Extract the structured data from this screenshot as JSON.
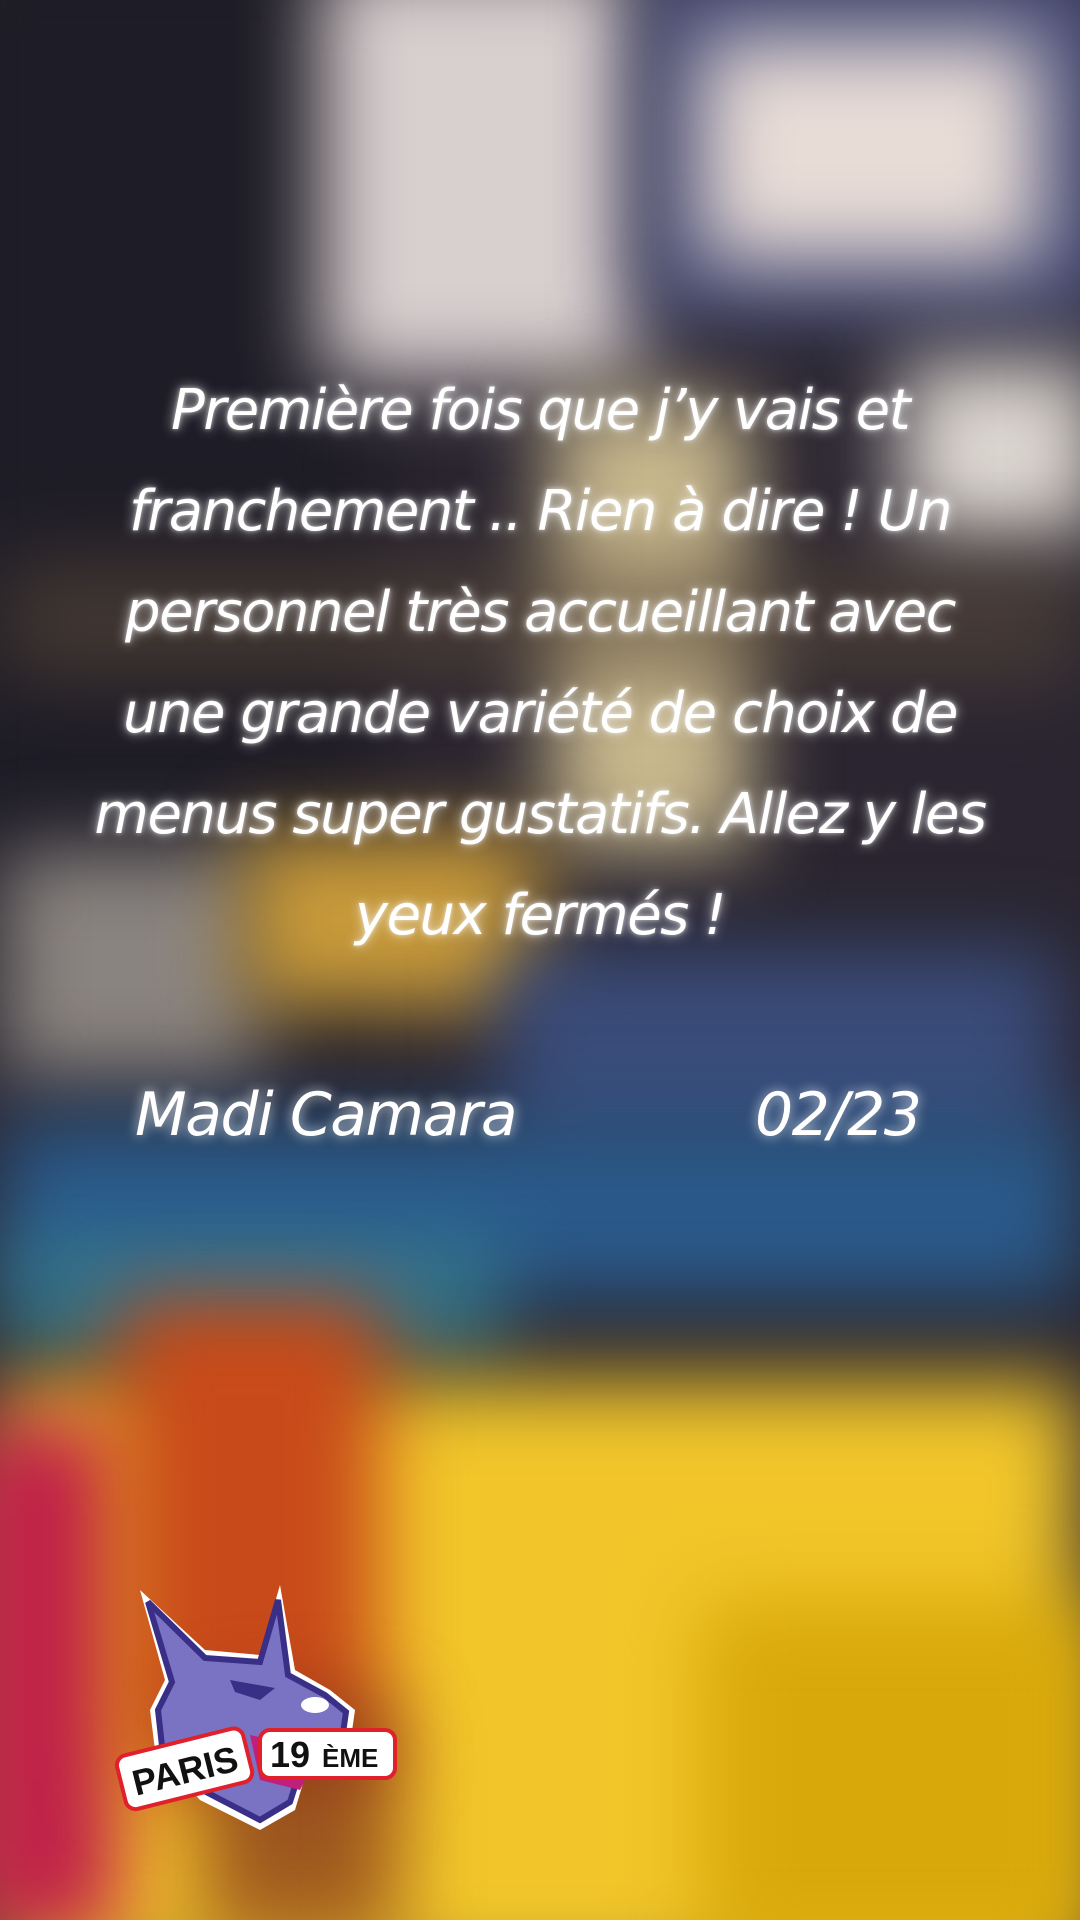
{
  "review": {
    "text": "Première fois que j’y vais et franchement .. Rien à dire ! Un personnel très accueillant avec une grande variété de choix de menus super gustatifs.  Allez y les yeux fermés !",
    "author": "Madi Camara",
    "date": "02/23"
  },
  "logo": {
    "plate_left": "PARIS",
    "plate_right_number": "19",
    "plate_right_suffix": "ÈME",
    "colors": {
      "wolf": "#7a72c2",
      "outline": "#3a2f86",
      "plate_border": "#e0202a",
      "tongue": "#c0207a"
    }
  },
  "colors": {
    "text": "#ffffff",
    "table_yellow": "#f2c62a"
  }
}
